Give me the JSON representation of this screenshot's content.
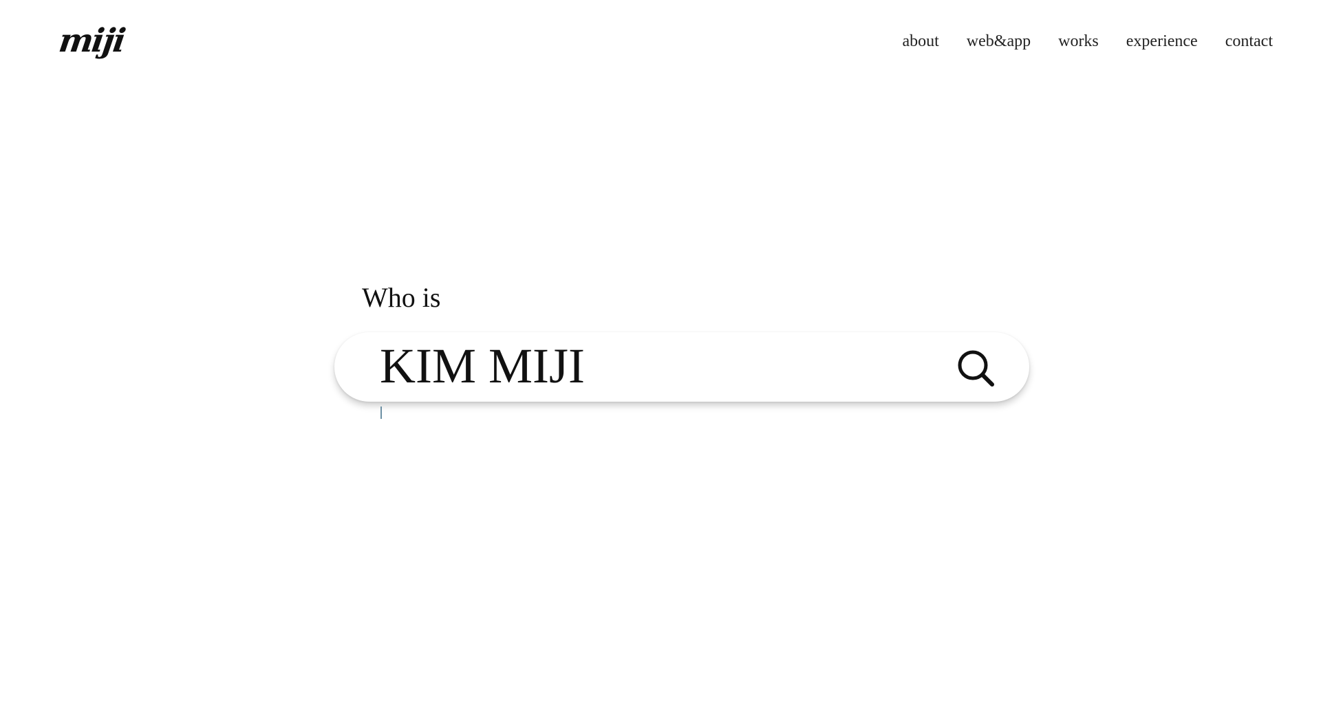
{
  "header": {
    "logo": "miji",
    "nav": [
      {
        "label": "about"
      },
      {
        "label": "web&app"
      },
      {
        "label": "works"
      },
      {
        "label": "experience"
      },
      {
        "label": "contact"
      }
    ]
  },
  "hero": {
    "prompt": "Who is",
    "search_value": "KIM MIJI",
    "search_icon": "search-icon"
  },
  "colors": {
    "text": "#111111",
    "background": "#ffffff",
    "caret": "#6b8fa3"
  }
}
